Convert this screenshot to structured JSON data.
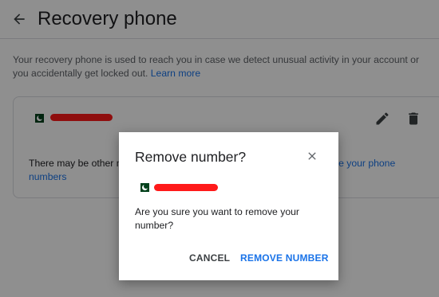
{
  "header": {
    "title": "Recovery phone"
  },
  "description": {
    "text": "Your recovery phone is used to reach you in case we detect unusual activity in your account or you accidentally get locked out.",
    "link": "Learn more"
  },
  "card": {
    "phone_number": "",
    "other_numbers_prefix": "There may be other nu",
    "other_numbers_link_part1": "ge your phone",
    "other_numbers_link_part2": "numbers"
  },
  "dialog": {
    "title": "Remove number?",
    "message": "Are you sure you want to remove your number?",
    "cancel_label": "CANCEL",
    "confirm_label": "REMOVE NUMBER"
  },
  "icons": {
    "back": "arrow-back-icon",
    "edit": "pencil-icon",
    "delete": "trash-icon",
    "close": "close-icon",
    "flag": "pakistan-flag-icon"
  },
  "colors": {
    "accent": "#1a73e8",
    "redaction": "#ff1a1a",
    "flag_green": "#01411c"
  }
}
